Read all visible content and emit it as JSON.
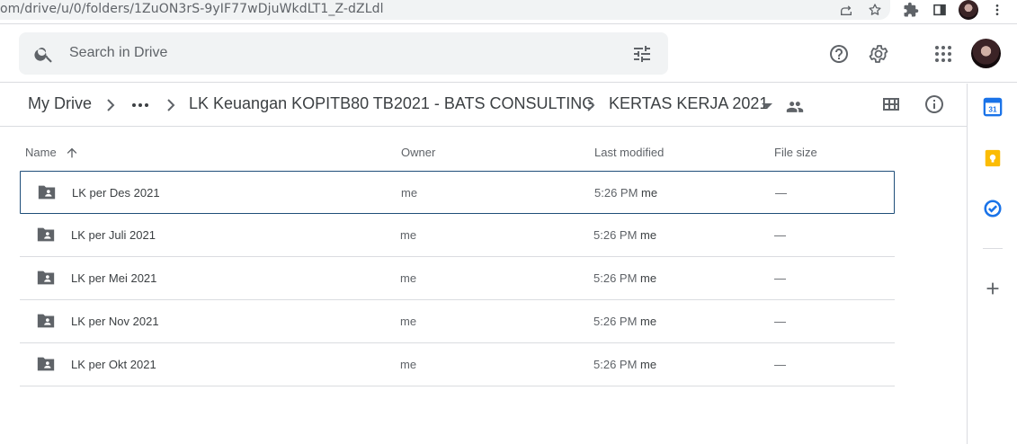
{
  "browser": {
    "url": "om/drive/u/0/folders/1ZuON3rS-9yIF77wDjuWkdLT1_Z-dZLdl"
  },
  "header": {
    "search_placeholder": "Search in Drive"
  },
  "breadcrumb": {
    "root": "My Drive",
    "parent": "LK Keuangan KOPITB80 TB2021 - BATS CONSULTING",
    "current": "KERTAS KERJA 2021"
  },
  "table": {
    "columns": {
      "name": "Name",
      "owner": "Owner",
      "last_modified": "Last modified",
      "file_size": "File size"
    },
    "rows": [
      {
        "name": "LK per Des 2021",
        "owner": "me",
        "modified_time": "5:26 PM",
        "modified_by": "me",
        "size": "—"
      },
      {
        "name": "LK per Juli 2021",
        "owner": "me",
        "modified_time": "5:26 PM",
        "modified_by": "me",
        "size": "—"
      },
      {
        "name": "LK per Mei 2021",
        "owner": "me",
        "modified_time": "5:26 PM",
        "modified_by": "me",
        "size": "—"
      },
      {
        "name": "LK per Nov 2021",
        "owner": "me",
        "modified_time": "5:26 PM",
        "modified_by": "me",
        "size": "—"
      },
      {
        "name": "LK per Okt 2021",
        "owner": "me",
        "modified_time": "5:26 PM",
        "modified_by": "me",
        "size": "—"
      }
    ]
  },
  "side_panel": {
    "calendar_day": "31"
  },
  "colors": {
    "selected_border": "#1f4e79",
    "calendar_blue": "#1a73e8",
    "keep_yellow": "#fbbc04",
    "tasks_blue": "#1a73e8"
  },
  "icons": [
    "search-icon",
    "tune-icon",
    "help-icon",
    "gear-icon",
    "apps-grid-icon",
    "chevron-right-icon",
    "more-horiz-icon",
    "dropdown-arrow-icon",
    "shared-people-icon",
    "grid-view-icon",
    "info-icon",
    "arrow-up-icon",
    "shared-folder-icon",
    "calendar-icon",
    "keep-icon",
    "tasks-icon",
    "plus-icon",
    "share-icon",
    "star-icon",
    "extensions-icon",
    "side-panel-icon",
    "kebab-icon"
  ]
}
